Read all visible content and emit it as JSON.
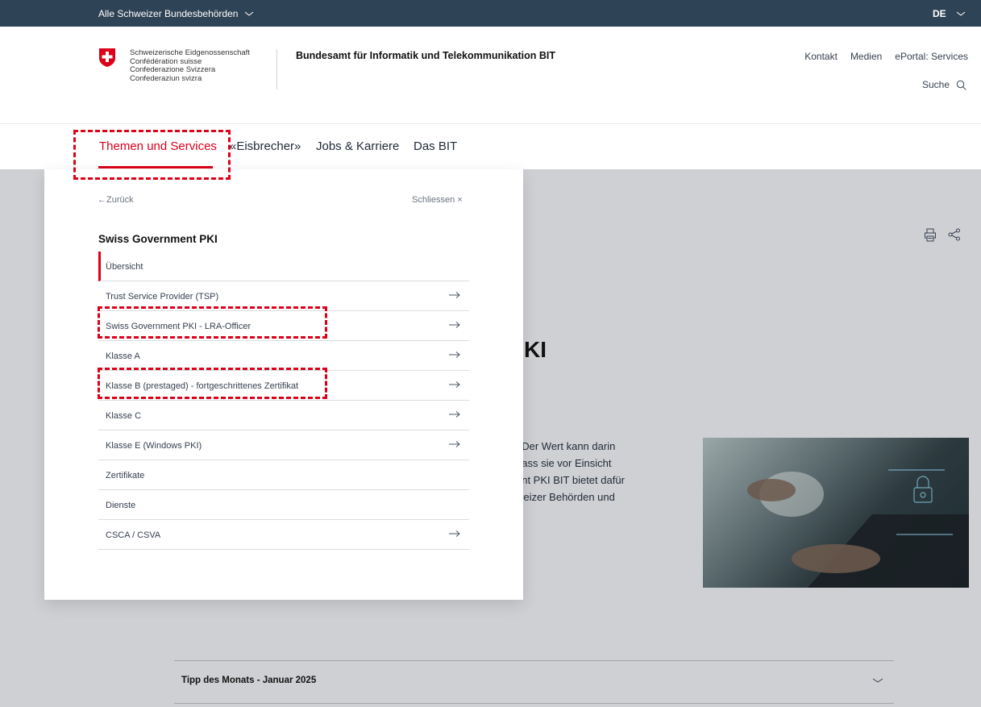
{
  "topbar": {
    "agencies_label": "Alle Schweizer Bundesbehörden",
    "language": "DE"
  },
  "header": {
    "confederation_lines": [
      "Schweizerische Eidgenossenschaft",
      "Confédération suisse",
      "Confederazione Svizzera",
      "Confederaziun svizra"
    ],
    "office_name": "Bundesamt für Informatik und Telekommunikation BIT",
    "meta_nav": [
      "Kontakt",
      "Medien",
      "ePortal: Services"
    ],
    "search_label": "Suche"
  },
  "main_nav": {
    "items": [
      "Themen und Services",
      "«Eisbrecher»",
      "Jobs & Karriere",
      "Das BIT"
    ],
    "active_index": 0
  },
  "dropdown": {
    "back_label": "Zurück",
    "close_label": "Schliessen",
    "title": "Swiss Government PKI",
    "items": [
      {
        "label": "Übersicht",
        "has_arrow": false,
        "current": true
      },
      {
        "label": "Trust Service Provider (TSP)",
        "has_arrow": true
      },
      {
        "label": "Swiss Government PKI - LRA-Officer",
        "has_arrow": true
      },
      {
        "label": "Klasse A",
        "has_arrow": true
      },
      {
        "label": "Klasse B (prestaged) - fortgeschrittenes Zertifikat",
        "has_arrow": true
      },
      {
        "label": "Klasse C",
        "has_arrow": true
      },
      {
        "label": "Klasse E (Windows PKI)",
        "has_arrow": true
      },
      {
        "label": "Zertifikate",
        "has_arrow": false
      },
      {
        "label": "Dienste",
        "has_arrow": false
      },
      {
        "label": "CSCA / CSVA",
        "has_arrow": true
      }
    ]
  },
  "page": {
    "title_fragment": "KI",
    "intro_lines": [
      ". Der Wert kann darin",
      "dass sie vor Einsicht",
      "ent PKI BIT bietet dafür",
      "weizer Behörden und"
    ]
  },
  "accordion": {
    "title": "Tipp des Monats - Januar 2025"
  },
  "colors": {
    "brand_red": "#dc0018",
    "topbar": "#2f4356",
    "page_bg": "#cfd0d3"
  }
}
